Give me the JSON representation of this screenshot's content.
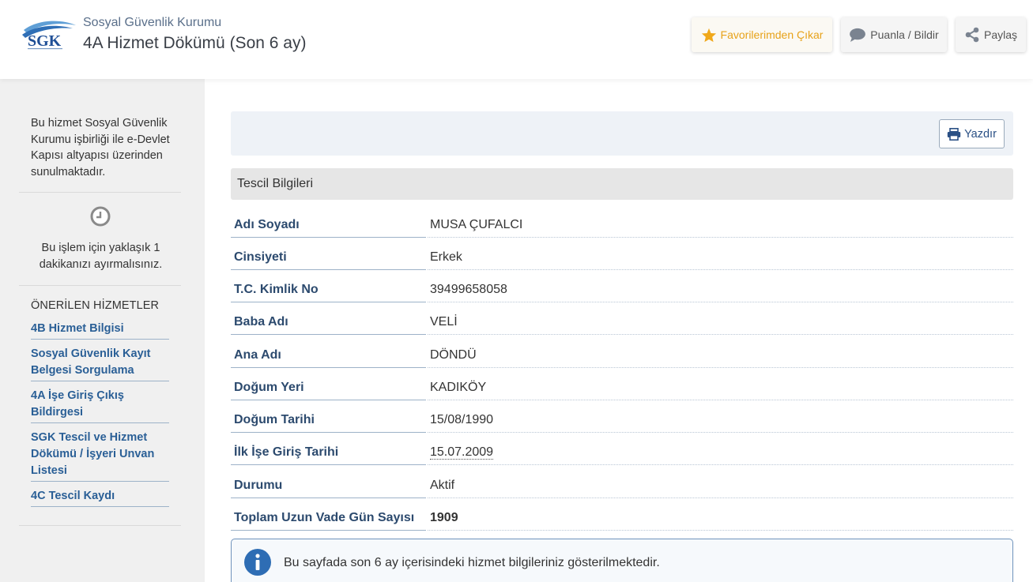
{
  "header": {
    "org_name": "Sosyal Güvenlik Kurumu",
    "page_title": "4A Hizmet Dökümü (Son 6 ay)",
    "logo_text": "SGK",
    "buttons": {
      "favorite": "Favorilerimden Çıkar",
      "rate": "Puanla / Bildir",
      "share": "Paylaş"
    }
  },
  "sidebar": {
    "info": "Bu hizmet Sosyal Güvenlik Kurumu işbirliği ile e-Devlet Kapısı altyapısı üzerinden sunulmaktadır.",
    "time_text": "Bu işlem için yaklaşık 1 dakikanızı ayırmalısınız.",
    "recommended_heading": "ÖNERİLEN HİZMETLER",
    "links": [
      "4B Hizmet Bilgisi",
      "Sosyal Güvenlik Kayıt Belgesi Sorgulama",
      "4A İşe Giriş Çıkış Bildirgesi",
      "SGK Tescil ve Hizmet Dökümü / İşyeri Unvan Listesi",
      "4C Tescil Kaydı"
    ]
  },
  "main": {
    "print_label": "Yazdır",
    "section_title": "Tescil Bilgileri",
    "rows": [
      {
        "label": "Adı Soyadı",
        "value": "MUSA ÇUFALCI"
      },
      {
        "label": "Cinsiyeti",
        "value": "Erkek"
      },
      {
        "label": "T.C. Kimlik No",
        "value": "39499658058"
      },
      {
        "label": "Baba Adı",
        "value": "VELİ"
      },
      {
        "label": "Ana Adı",
        "value": "DÖNDÜ"
      },
      {
        "label": "Doğum Yeri",
        "value": "KADIKÖY"
      },
      {
        "label": "Doğum Tarihi",
        "value": "15/08/1990"
      },
      {
        "label": "İlk İşe Giriş Tarihi",
        "value": "15.07.2009"
      },
      {
        "label": "Durumu",
        "value": "Aktif"
      },
      {
        "label": "Toplam Uzun Vade Gün Sayısı",
        "value": "1909"
      }
    ],
    "info_message": "Bu sayfada son 6 ay içerisindeki hizmet bilgileriniz gösterilmektedir."
  },
  "colors": {
    "favorite": "#e7a21a",
    "link": "#2a5f96",
    "label": "#2c4a6e",
    "info_icon": "#2e6db4"
  }
}
